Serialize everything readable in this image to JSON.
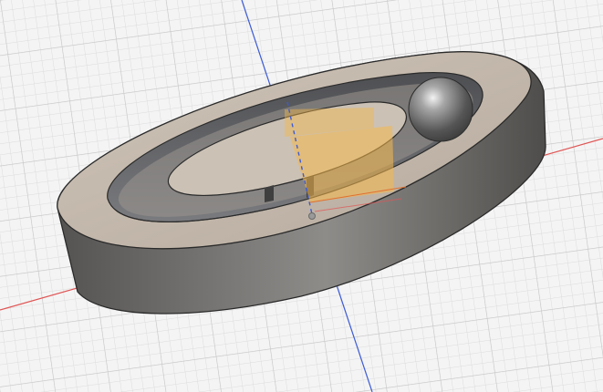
{
  "viewport": {
    "background_color": "#f3f3f3",
    "grid_minor_color": "#dedede",
    "grid_major_color": "#c4c4c4",
    "axis_x_color": "#e05050",
    "axis_y_color": "#3a5ad8",
    "axis_z_color": "#5aa05a"
  },
  "model": {
    "body_top_color": "#c3b8ac",
    "body_wall_color": "#5f5d5b",
    "inner_wall_color": "#6a6b6d",
    "disc_color": "#c9beb2",
    "ball_color": "#777777",
    "sketch_plane_color": "#f5b84a",
    "edge_color": "#2a2a2a"
  },
  "icons": {
    "origin_point": "origin-point-icon"
  }
}
